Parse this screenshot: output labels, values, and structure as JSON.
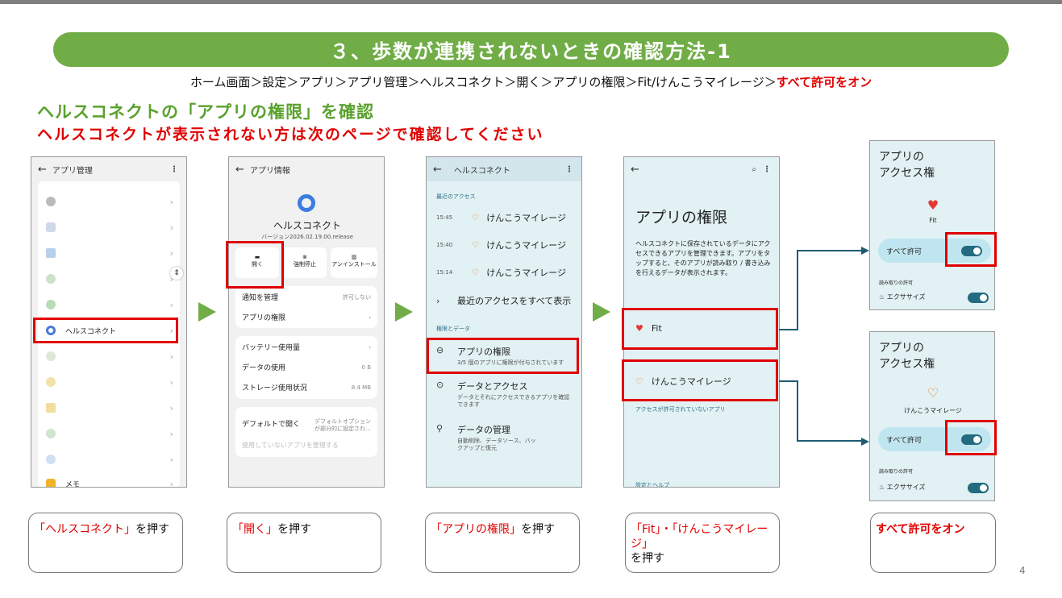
{
  "title": "３、歩数が連携されないときの確認方法-1",
  "breadcrumb": {
    "path": "ホーム画面＞設定＞アプリ＞アプリ管理＞ヘルスコネクト＞開く＞アプリの権限＞Fit/けんこうマイレージ＞",
    "highlight": "すべて許可をオン"
  },
  "heading_green": "ヘルスコネクトの「アプリの権限」を確認",
  "heading_red": "ヘルスコネクトが表示されない方は次のページで確認してください",
  "phone1": {
    "header": "アプリ管理",
    "highlight_item": "ヘルスコネクト",
    "last_item": "メモ"
  },
  "phone2": {
    "header": "アプリ情報",
    "app_name": "ヘルスコネクト",
    "version": "バージョン2026.02.19.00.release",
    "actions": [
      "開く",
      "強制停止",
      "アンインストール"
    ],
    "rows1": [
      {
        "label": "通知を管理",
        "value": "許可しない"
      },
      {
        "label": "アプリの権限",
        "value": ""
      }
    ],
    "rows2": [
      {
        "label": "バッテリー使用量",
        "value": ""
      },
      {
        "label": "データの使用",
        "value": "0 B"
      },
      {
        "label": "ストレージ使用状況",
        "value": "8.4 MB"
      }
    ],
    "default_open": "デフォルトで開く",
    "default_open_value": "デフォルトオプションが部分的に設定され...",
    "unused_apps": "使用していないアプリを管理する"
  },
  "phone3": {
    "header": "ヘルスコネクト",
    "recent_section": "最近のアクセス",
    "recent": [
      {
        "time": "15:45",
        "app": "けんこうマイレージ"
      },
      {
        "time": "15:40",
        "app": "けんこうマイレージ"
      },
      {
        "time": "15:14",
        "app": "けんこうマイレージ"
      }
    ],
    "show_all": "最近のアクセスをすべて表示",
    "perm_section": "権限とデータ",
    "items": [
      {
        "title": "アプリの権限",
        "sub": "3/5 個のアプリに権限が付与されています"
      },
      {
        "title": "データとアクセス",
        "sub": "データとそれにアクセスできるアプリを確認できます"
      },
      {
        "title": "データの管理",
        "sub": "自動削除、データソース、バックアップと復元"
      }
    ]
  },
  "phone4": {
    "title": "アプリの権限",
    "desc": "ヘルスコネクトに保存されているデータにアクセスできるアプリを管理できます。アプリをタップすると、そのアプリが読み取り / 書き込みを行えるデータが表示されます。",
    "app1": "Fit",
    "app2": "けんこうマイレージ",
    "not_allowed_section": "アクセスが許可されていないアプリ",
    "settings_section": "設定とヘルプ"
  },
  "phone5a": {
    "title": "アプリの\nアクセス権",
    "app": "Fit",
    "allow_all": "すべて許可",
    "read_section": "読み取りの許可",
    "exercise": "エクササイズ"
  },
  "phone5b": {
    "title": "アプリの\nアクセス権",
    "app": "けんこうマイレージ",
    "allow_all": "すべて許可",
    "read_section": "読み取りの許可",
    "exercise": "エクササイズ"
  },
  "captions": [
    {
      "red": "「ヘルスコネクト」",
      "black": "を押す"
    },
    {
      "red": "「開く」",
      "black": "を押す"
    },
    {
      "red": "「アプリの権限」",
      "black": "を押す"
    },
    {
      "red": "「Fit」・「けんこうマイレージ」",
      "black": "を押す"
    },
    {
      "red": "すべて許可をオン",
      "black": ""
    }
  ],
  "page_number": "4",
  "colors": {
    "green": "#70ad47",
    "red": "#e00000",
    "teal": "#236b80"
  }
}
